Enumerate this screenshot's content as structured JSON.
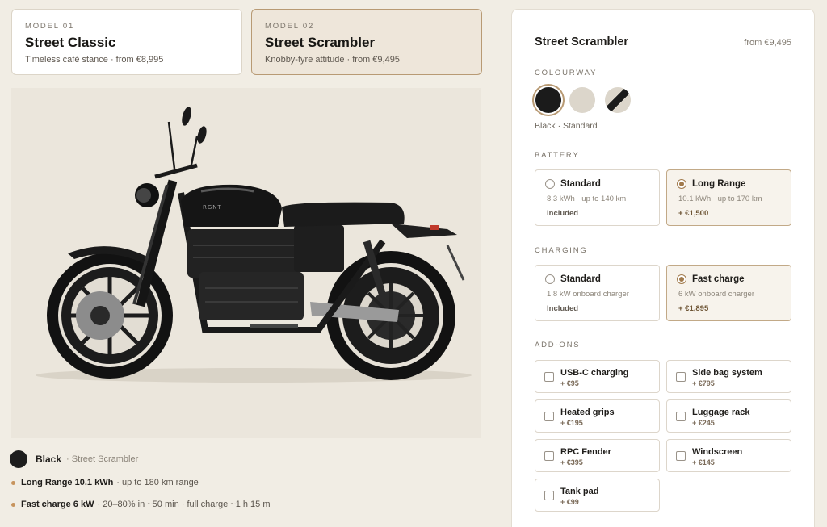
{
  "models": [
    {
      "kicker": "MODEL 01",
      "name": "Street Classic",
      "sub": "Timeless café stance · from €8,995"
    },
    {
      "kicker": "MODEL 02",
      "name": "Street Scrambler",
      "sub": "Knobby-tyre attitude · from €9,495"
    }
  ],
  "hero": {
    "tank_badge": "RGNT"
  },
  "summary": {
    "color": "Black",
    "model": "· Street Scrambler",
    "specs": [
      {
        "strong": "Long Range 10.1 kWh",
        "rest": "· up to 180 km range"
      },
      {
        "strong": "Fast charge 6 kW",
        "rest": "· 20–80% in ~50 min · full charge ~1 h 15 m"
      }
    ]
  },
  "panel": {
    "title": "Street Scrambler",
    "price": "from €9,495",
    "colourway_label": "COLOURWAY",
    "colourway_caption": "Black · Standard",
    "colours": [
      {
        "name": "black",
        "color": "#1b1b1b"
      },
      {
        "name": "sand",
        "color": "#dcd6cb"
      },
      {
        "name": "sand-with-black-stripe",
        "color": "#dcd6cb"
      }
    ],
    "battery_label": "BATTERY",
    "battery": [
      {
        "name": "Standard",
        "desc": "8.3 kWh · up to 140 km",
        "price": "Included"
      },
      {
        "name": "Long Range",
        "desc": "10.1 kWh · up to 170 km",
        "price": "+ €1,500"
      }
    ],
    "charging_label": "CHARGING",
    "charging": [
      {
        "name": "Standard",
        "desc": "1.8 kW onboard charger",
        "price": "Included"
      },
      {
        "name": "Fast charge",
        "desc": "6 kW onboard charger",
        "price": "+ €1,895"
      }
    ],
    "addons_label": "ADD-ONS",
    "addons": [
      {
        "name": "USB-C charging",
        "price": "+ €95"
      },
      {
        "name": "Side bag system",
        "price": "+ €795"
      },
      {
        "name": "Heated grips",
        "price": "+ €195"
      },
      {
        "name": "Luggage rack",
        "price": "+ €245"
      },
      {
        "name": "RPC Fender",
        "price": "+ €395"
      },
      {
        "name": "Windscreen",
        "price": "+ €145"
      },
      {
        "name": "Tank pad",
        "price": "+ €99"
      }
    ]
  },
  "colors": {
    "accent": "#b89a74",
    "page_bg": "#f1ede4",
    "hero_bg": "#ebe6dc"
  }
}
